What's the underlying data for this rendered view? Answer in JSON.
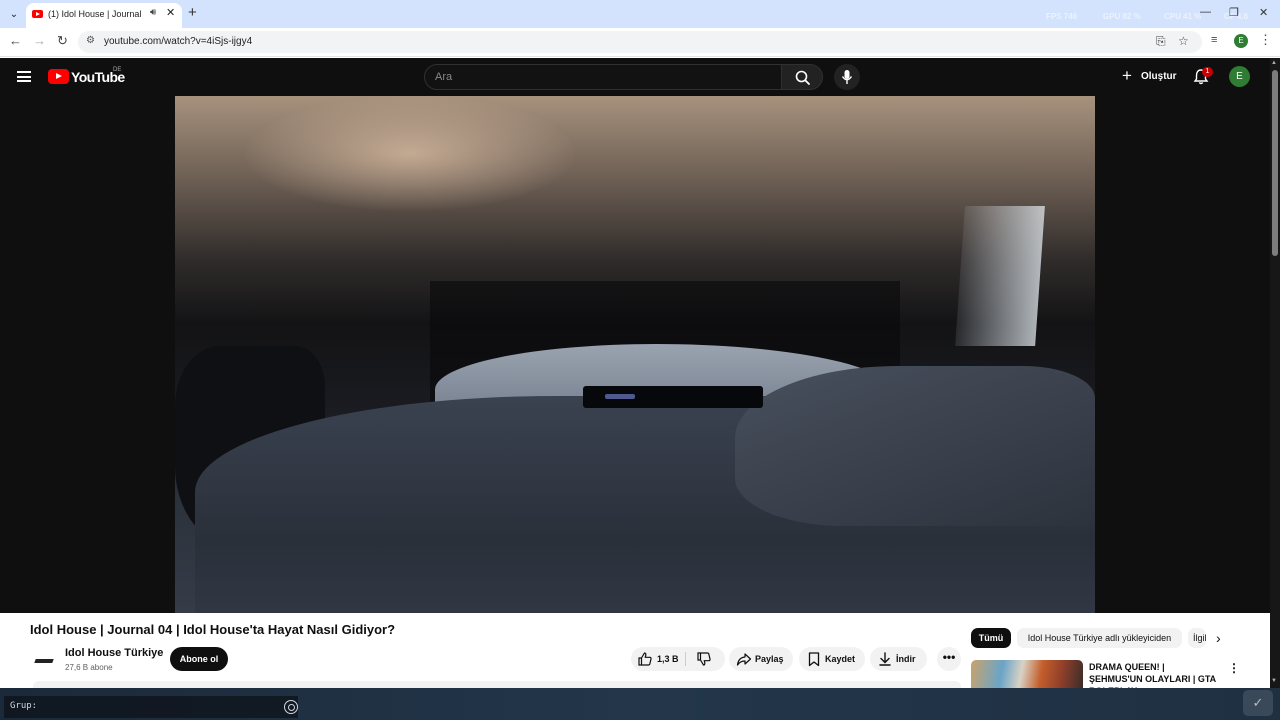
{
  "browser": {
    "tab": {
      "title": "(1) Idol House | Journal 04 | Idol House'ta Hayat Nasıl Gidiyor? - YouTube"
    },
    "perf": [
      {
        "label": "FPS",
        "value": "746"
      },
      {
        "label": "GPU",
        "value": "82 %"
      },
      {
        "label": "CPU",
        "value": "41 %"
      },
      {
        "label": "CF",
        "value": "4.6"
      }
    ],
    "url": "youtube.com/watch?v=4iSjs-ijgy4",
    "profile_initial": "E"
  },
  "youtube": {
    "logo_text": "YouTube",
    "country_code": "DE",
    "search_placeholder": "Ara",
    "create_label": "Oluştur",
    "notification_count": "1",
    "avatar_initial": "E"
  },
  "video": {
    "title": "Idol House | Journal 04 | Idol House'ta Hayat Nasıl Gidiyor?",
    "channel_name": "Idol House Türkiye",
    "subscriber_count": "27,6 B abone",
    "subscribe_label": "Abone ol",
    "like_count": "1,3 B",
    "share_label": "Paylaş",
    "save_label": "Kaydet",
    "download_label": "İndir",
    "more_label": "•••"
  },
  "sidebar": {
    "chips": [
      "Tümü",
      "Idol House Türkiye adlı yükleyiciden",
      "İlgili"
    ],
    "recommendation": {
      "title": "DRAMA QUEEN! | ŞEHMUS'UN OLAYLARI | GTA ROLEPLAY ..."
    }
  },
  "taskbar": {
    "group_label": "Grup:"
  },
  "colors": {
    "brand_red": "#ff0000",
    "page_dark": "#0f0f0f",
    "badge_red": "#cc0000",
    "avatar_green": "#2e7d32"
  }
}
